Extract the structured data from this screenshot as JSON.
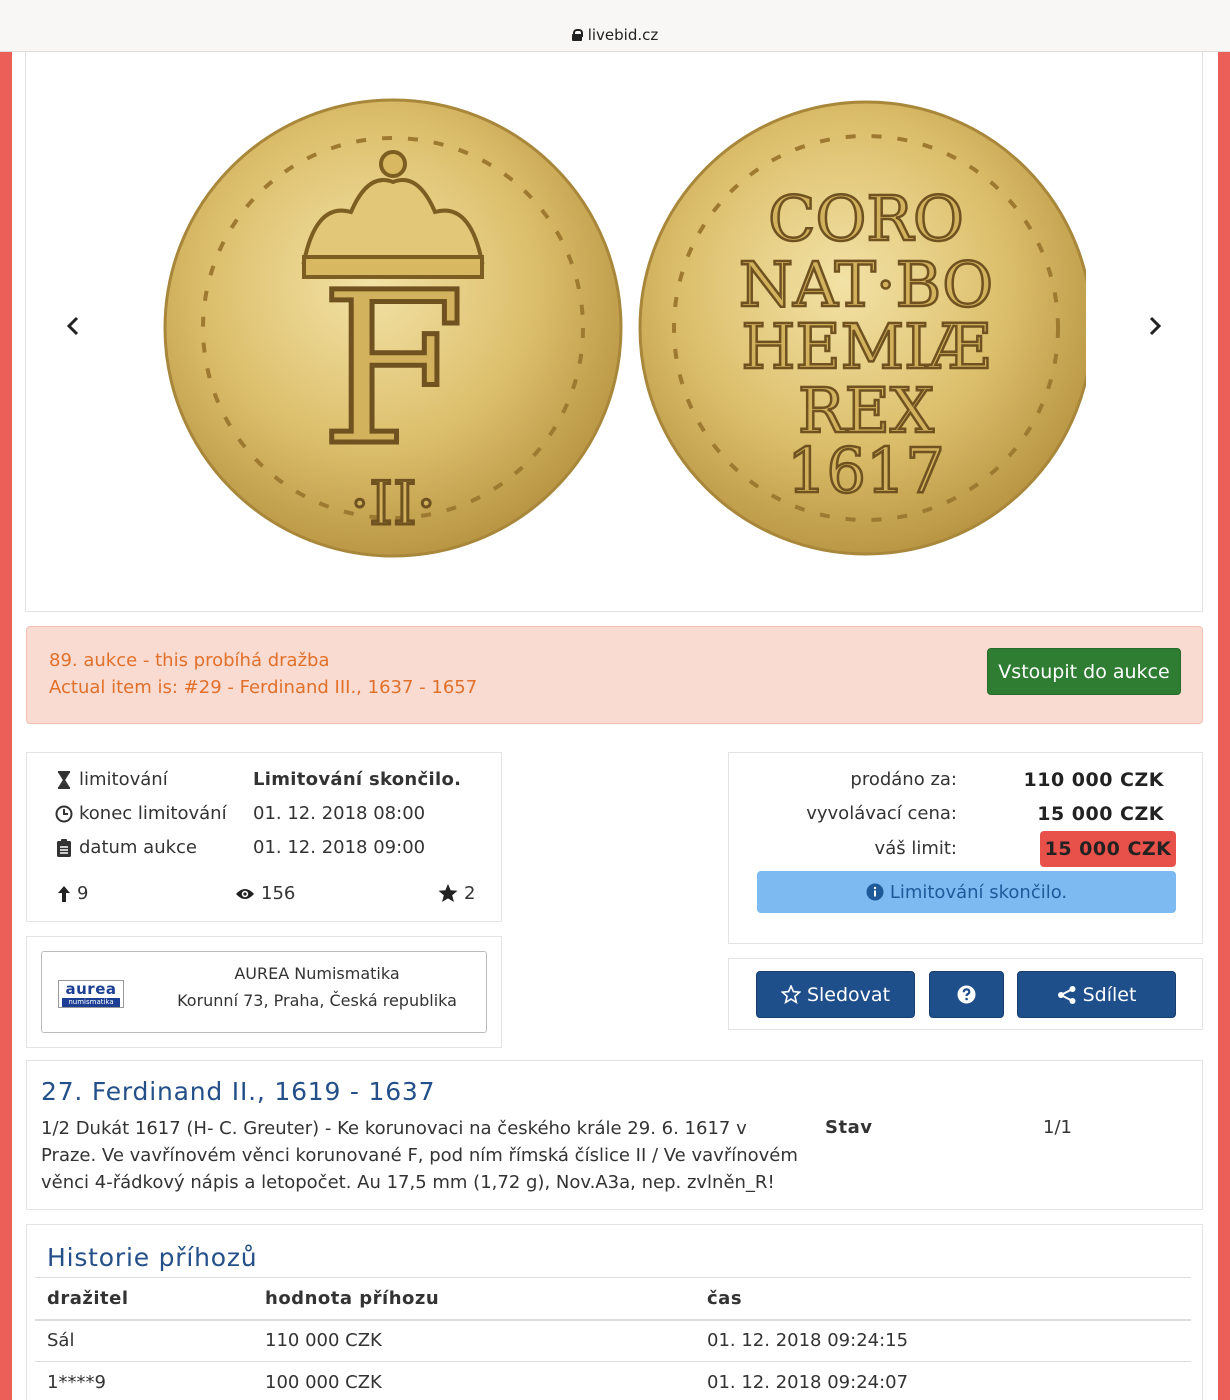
{
  "browser": {
    "url": "livebid.cz"
  },
  "gallery": {
    "prev_icon": "chevron-left-icon",
    "next_icon": "chevron-right-icon",
    "coin_obverse": {
      "numeral": "·II·",
      "letter": "F"
    },
    "coin_reverse": {
      "lines": [
        "CORO",
        "NAT·BO",
        "HEMIÆ",
        "REX",
        "1617"
      ]
    }
  },
  "alert": {
    "line1": "89. aukce - this probíhá dražba",
    "line2": "Actual item is: #29 - Ferdinand III., 1637 - 1657",
    "button": "Vstoupit do aukce"
  },
  "info": {
    "rows": [
      {
        "icon": "hourglass-icon",
        "label": "limitování",
        "value": "Limitování skončilo."
      },
      {
        "icon": "clock-icon",
        "label": "konec limitování",
        "value": "01. 12. 2018 08:00"
      },
      {
        "icon": "clipboard-icon",
        "label": "datum aukce",
        "value": "01. 12. 2018 09:00"
      }
    ],
    "stats": {
      "bids": "9",
      "views": "156",
      "stars": "2"
    }
  },
  "seller": {
    "logo_top": "aurea",
    "logo_bottom": "numismatika",
    "name": "AUREA Numismatika",
    "address": "Korunní 73, Praha, Česká republika"
  },
  "price": {
    "sold_label": "prodáno za:",
    "sold_value": "110 000 CZK",
    "start_label": "vyvolávací cena:",
    "start_value": "15 000 CZK",
    "limit_label": "váš limit:",
    "limit_value": "15 000 CZK",
    "limit_status": "Limitování skončilo."
  },
  "actions": {
    "follow": "Sledovat",
    "share": "Sdílet"
  },
  "item": {
    "title": "27. Ferdinand II., 1619 - 1637",
    "description": "1/2 Dukát 1617 (H- C. Greuter) - Ke korunovaci na českého krále 29. 6. 1617 v Praze. Ve vavřínovém věnci korunované F, pod ním římská číslice II / Ve vavřínovém věnci 4-řádkový nápis a letopočet. Au 17,5 mm (1,72 g), Nov.A3a, nep. zvlněn_R!",
    "stav_label": "Stav",
    "stav_value": "1/1"
  },
  "history": {
    "title": "Historie příhozů",
    "columns": [
      "dražitel",
      "hodnota příhozu",
      "čas"
    ],
    "rows": [
      [
        "Sál",
        "110 000 CZK",
        "01. 12. 2018 09:24:15"
      ],
      [
        "1****9",
        "100 000 CZK",
        "01. 12. 2018 09:24:07"
      ]
    ]
  },
  "colors": {
    "brand_red": "#ec5f59",
    "green": "#2e7d32",
    "navy": "#1f4f8b",
    "title_blue": "#24508a",
    "gold": "#d6b45c"
  }
}
